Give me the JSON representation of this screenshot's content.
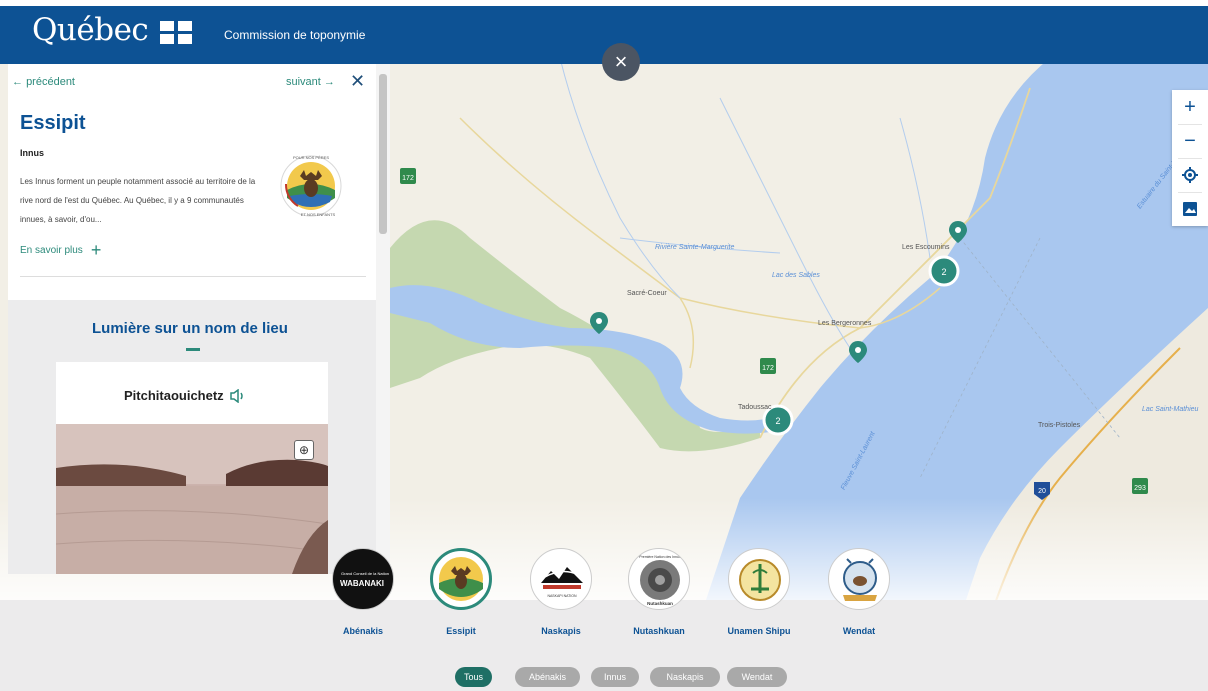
{
  "header": {
    "logo_text": "Québec",
    "title": "Commission de toponymie"
  },
  "overlay": {
    "close_icon": "close-icon"
  },
  "detail": {
    "prev_label": "précédent",
    "next_label": "suivant",
    "title": "Essipit",
    "subtitle": "Innus",
    "description": "Les Innus forment un peuple notamment associé au territoire de la rive nord de l'est du Québec. Au Québec, il y a 9 communautés innues, à savoir, d'ou...",
    "more_label": "En savoir plus"
  },
  "spotlight": {
    "heading": "Lumière sur un nom de lieu",
    "place_name": "Pitchitaouichetz"
  },
  "map": {
    "labels": {
      "sacre_coeur": "Sacré-Coeur",
      "les_escoumins": "Les Escoumins",
      "les_bergeronnes": "Les Bergeronnes",
      "tadoussac": "Tadoussac",
      "trois_pistoles": "Trois-Pistoles",
      "riviere": "Rivière Sainte-Marguerite",
      "lac_des_sables": "Lac des Sables",
      "lac_saint_mathieu": "Lac Saint-Mathieu",
      "fleuve": "Fleuve Saint-Laurent",
      "estuaire": "Estuaire du Saint-Laurent",
      "route_172a": "172",
      "route_172b": "172",
      "route_293": "293",
      "route_20": "20",
      "cluster_1": "2",
      "cluster_2": "2"
    },
    "accent": "#2c8a7b",
    "water": "#a9c7ef",
    "land": "#f2efe6",
    "park": "#c5d8b0"
  },
  "communities": [
    {
      "name": "Abénakis"
    },
    {
      "name": "Essipit"
    },
    {
      "name": "Naskapis"
    },
    {
      "name": "Nutashkuan"
    },
    {
      "name": "Unamen Shipu"
    },
    {
      "name": "Wendat"
    }
  ],
  "logo_texts": {
    "wabanaki_small": "Grand Conseil de la Nation",
    "wabanaki": "WABANAKI",
    "naskapi": "NASKAPI NATION",
    "nutashkuan_top": "Première Nation des Innus",
    "nutashkuan": "Nutashkuan",
    "essipit_top": "POUR NOS PÈRES",
    "essipit_bottom": "ET NOS ENFANTS"
  },
  "filters": [
    {
      "label": "Tous",
      "active": true
    },
    {
      "label": "Abénakis",
      "active": false
    },
    {
      "label": "Innus",
      "active": false
    },
    {
      "label": "Naskapis",
      "active": false
    },
    {
      "label": "Wendat",
      "active": false
    }
  ]
}
